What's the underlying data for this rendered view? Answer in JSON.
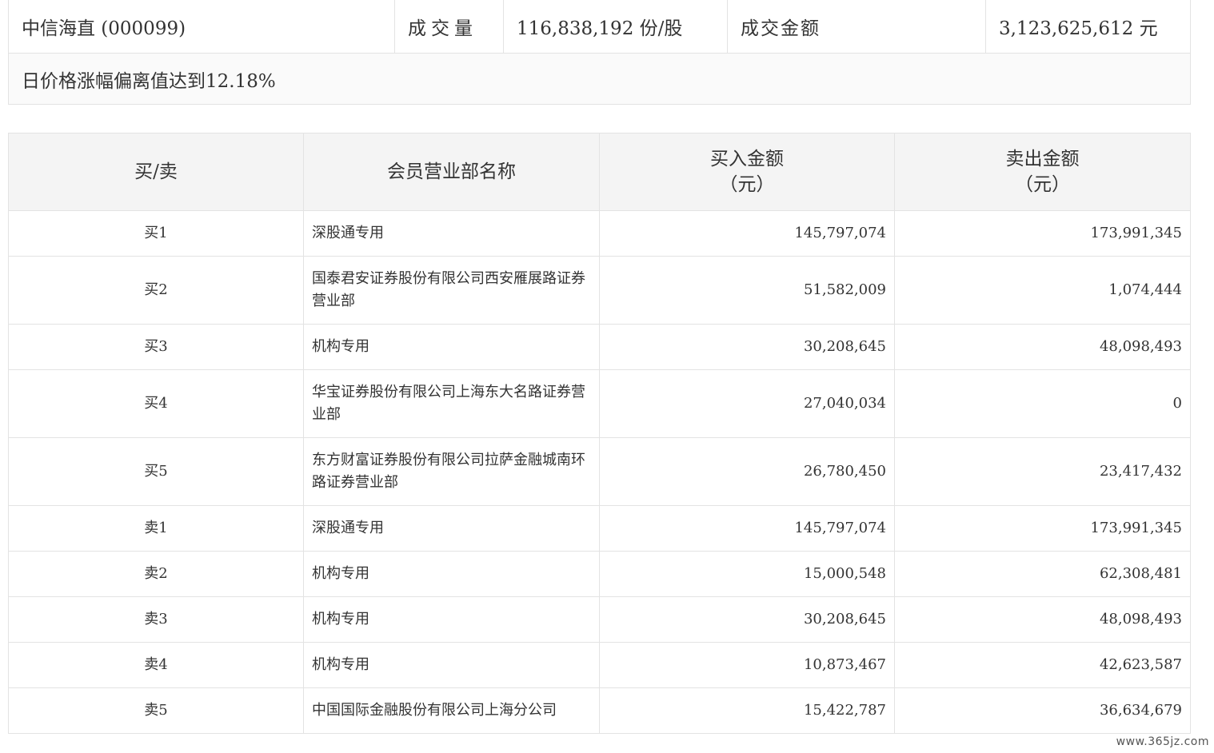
{
  "summary": {
    "stock_name": "中信海直 (000099)",
    "volume_label": "成交量",
    "volume_value": "116,838,192 份/股",
    "amount_label": "成交金额",
    "amount_value": "3,123,625,612 元",
    "reason": "日价格涨幅偏离值达到12.18%"
  },
  "trades": {
    "headers": {
      "side": "买/卖",
      "dept": "会员营业部名称",
      "buy_line1": "买入金额",
      "buy_line2": "（元）",
      "sell_line1": "卖出金额",
      "sell_line2": "（元）"
    },
    "rows": [
      {
        "side": "买1",
        "dept": "深股通专用",
        "buy": "145,797,074",
        "sell": "173,991,345"
      },
      {
        "side": "买2",
        "dept": "国泰君安证券股份有限公司西安雁展路证券营业部",
        "buy": "51,582,009",
        "sell": "1,074,444"
      },
      {
        "side": "买3",
        "dept": "机构专用",
        "buy": "30,208,645",
        "sell": "48,098,493"
      },
      {
        "side": "买4",
        "dept": "华宝证券股份有限公司上海东大名路证券营业部",
        "buy": "27,040,034",
        "sell": "0"
      },
      {
        "side": "买5",
        "dept": "东方财富证券股份有限公司拉萨金融城南环路证券营业部",
        "buy": "26,780,450",
        "sell": "23,417,432"
      },
      {
        "side": "卖1",
        "dept": "深股通专用",
        "buy": "145,797,074",
        "sell": "173,991,345"
      },
      {
        "side": "卖2",
        "dept": "机构专用",
        "buy": "15,000,548",
        "sell": "62,308,481"
      },
      {
        "side": "卖3",
        "dept": "机构专用",
        "buy": "30,208,645",
        "sell": "48,098,493"
      },
      {
        "side": "卖4",
        "dept": "机构专用",
        "buy": "10,873,467",
        "sell": "42,623,587"
      },
      {
        "side": "卖5",
        "dept": "中国国际金融股份有限公司上海分公司",
        "buy": "15,422,787",
        "sell": "36,634,679"
      }
    ]
  },
  "watermark": "www.365jz.com"
}
